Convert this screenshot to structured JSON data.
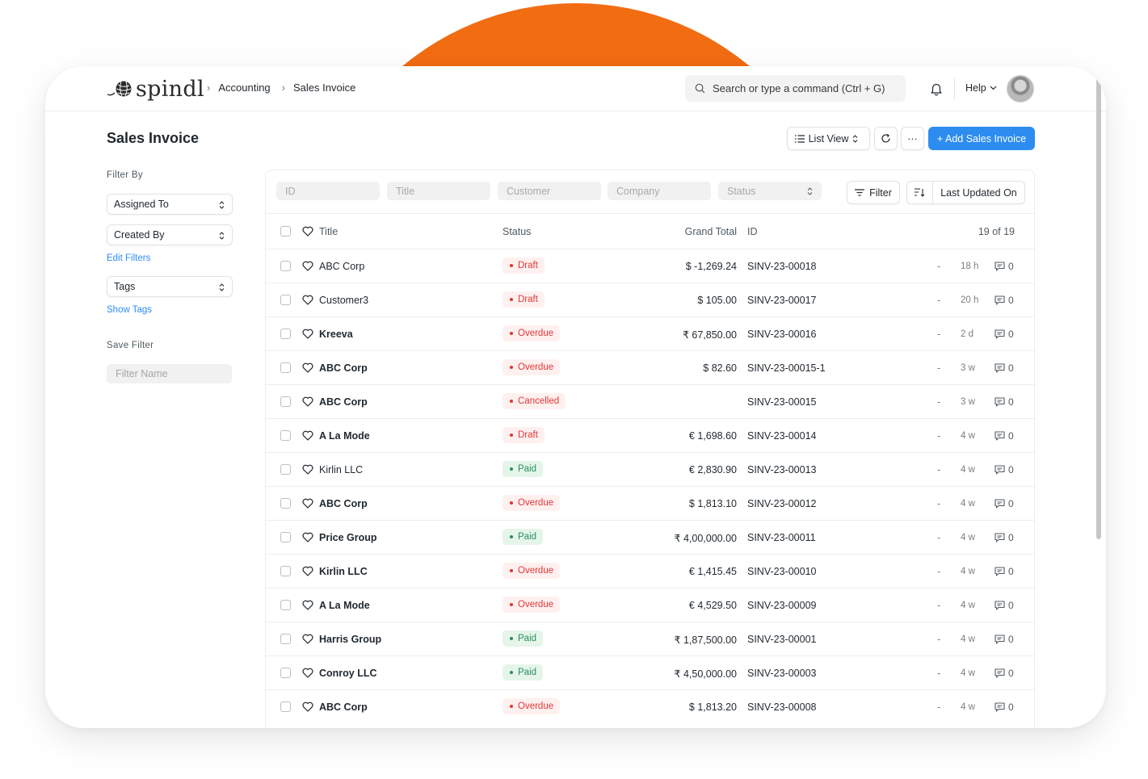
{
  "app": {
    "logo_text": "spindl"
  },
  "breadcrumbs": [
    "Accounting",
    "Sales Invoice"
  ],
  "search": {
    "placeholder": "Search or type a command (Ctrl + G)"
  },
  "nav": {
    "help_label": "Help"
  },
  "page": {
    "title": "Sales Invoice"
  },
  "toolbar": {
    "list_view_label": "List View",
    "more_label": "···",
    "add_label": "+ Add Sales Invoice"
  },
  "sidebar": {
    "filter_by_label": "Filter By",
    "assigned_to": "Assigned To",
    "created_by": "Created By",
    "edit_filters": "Edit Filters",
    "tags": "Tags",
    "show_tags": "Show Tags",
    "save_filter_label": "Save Filter",
    "filter_name_placeholder": "Filter Name"
  },
  "filters": {
    "id": "ID",
    "title": "Title",
    "customer": "Customer",
    "company": "Company",
    "status": "Status",
    "filter_button": "Filter",
    "sort_label": "Last Updated On"
  },
  "list": {
    "columns": {
      "title": "Title",
      "status": "Status",
      "grand_total": "Grand Total",
      "id": "ID",
      "count": "19 of 19"
    },
    "rows": [
      {
        "title": "ABC Corp",
        "bold": false,
        "status": "Draft",
        "tone": "red",
        "total": "$ -1,269.24",
        "id": "SINV-23-00018",
        "dash": "-",
        "time": "18 h",
        "comments": "0"
      },
      {
        "title": "Customer3",
        "bold": false,
        "status": "Draft",
        "tone": "red",
        "total": "$ 105.00",
        "id": "SINV-23-00017",
        "dash": "-",
        "time": "20 h",
        "comments": "0"
      },
      {
        "title": "Kreeva",
        "bold": true,
        "status": "Overdue",
        "tone": "red",
        "total": "₹ 67,850.00",
        "id": "SINV-23-00016",
        "dash": "-",
        "time": "2 d",
        "comments": "0"
      },
      {
        "title": "ABC Corp",
        "bold": true,
        "status": "Overdue",
        "tone": "red",
        "total": "$ 82.60",
        "id": "SINV-23-00015-1",
        "dash": "-",
        "time": "3 w",
        "comments": "0"
      },
      {
        "title": "ABC Corp",
        "bold": true,
        "status": "Cancelled",
        "tone": "red",
        "total": "",
        "id": "SINV-23-00015",
        "dash": "-",
        "time": "3 w",
        "comments": "0"
      },
      {
        "title": "A La Mode",
        "bold": true,
        "status": "Draft",
        "tone": "red",
        "total": "€ 1,698.60",
        "id": "SINV-23-00014",
        "dash": "-",
        "time": "4 w",
        "comments": "0"
      },
      {
        "title": "Kirlin LLC",
        "bold": false,
        "status": "Paid",
        "tone": "green",
        "total": "€ 2,830.90",
        "id": "SINV-23-00013",
        "dash": "-",
        "time": "4 w",
        "comments": "0"
      },
      {
        "title": "ABC Corp",
        "bold": true,
        "status": "Overdue",
        "tone": "red",
        "total": "$ 1,813.10",
        "id": "SINV-23-00012",
        "dash": "-",
        "time": "4 w",
        "comments": "0"
      },
      {
        "title": "Price Group",
        "bold": true,
        "status": "Paid",
        "tone": "green",
        "total": "₹ 4,00,000.00",
        "id": "SINV-23-00011",
        "dash": "-",
        "time": "4 w",
        "comments": "0"
      },
      {
        "title": "Kirlin LLC",
        "bold": true,
        "status": "Overdue",
        "tone": "red",
        "total": "€ 1,415.45",
        "id": "SINV-23-00010",
        "dash": "-",
        "time": "4 w",
        "comments": "0"
      },
      {
        "title": "A La Mode",
        "bold": true,
        "status": "Overdue",
        "tone": "red",
        "total": "€ 4,529.50",
        "id": "SINV-23-00009",
        "dash": "-",
        "time": "4 w",
        "comments": "0"
      },
      {
        "title": "Harris Group",
        "bold": true,
        "status": "Paid",
        "tone": "green",
        "total": "₹ 1,87,500.00",
        "id": "SINV-23-00001",
        "dash": "-",
        "time": "4 w",
        "comments": "0"
      },
      {
        "title": "Conroy LLC",
        "bold": true,
        "status": "Paid",
        "tone": "green",
        "total": "₹ 4,50,000.00",
        "id": "SINV-23-00003",
        "dash": "-",
        "time": "4 w",
        "comments": "0"
      },
      {
        "title": "ABC Corp",
        "bold": true,
        "status": "Overdue",
        "tone": "red",
        "total": "$ 1,813.20",
        "id": "SINV-23-00008",
        "dash": "-",
        "time": "4 w",
        "comments": "0"
      }
    ]
  },
  "colors": {
    "brand_orange": "#f26c12",
    "primary_blue": "#2d8cf0",
    "status_red": "#e03636",
    "status_green": "#278f5e"
  }
}
